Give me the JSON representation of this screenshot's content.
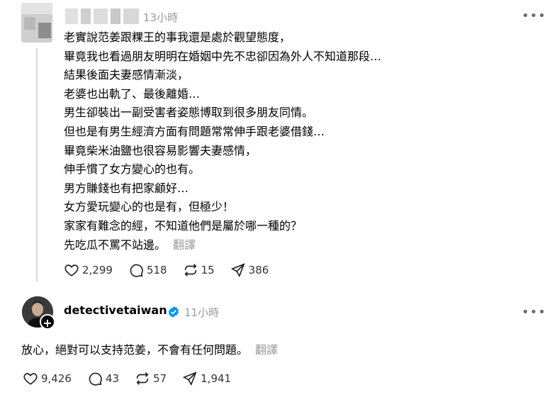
{
  "post": {
    "time": "13小時",
    "more_icon": "more-horizontal-icon",
    "lines": [
      "老實說范姜跟粿王的事我還是處於觀望態度，",
      "畢竟我也看過朋友明明在婚姻中先不忠卻因為外人不知道那段…",
      "結果後面夫妻感情漸淡，",
      "老婆也出軌了、最後離婚…",
      "男生卻裝出一副受害者姿態博取到很多朋友同情。",
      "但也是有男生經濟方面有問題常常伸手跟老婆借錢…",
      "畢竟柴米油鹽也很容易影響夫妻感情，",
      "伸手慣了女方變心的也有。",
      "男方賺錢也有把家顧好…",
      "女方愛玩變心的也是有，但極少！",
      "家家有難念的經，不知道他們是屬於哪一種的？",
      "先吃瓜不罵不站邊。"
    ],
    "translate": "翻譯",
    "likes": "2,299",
    "comments": "518",
    "reposts": "15",
    "shares": "386"
  },
  "reply": {
    "username": "detectivetaiwan",
    "time": "11小時",
    "text": "放心，絕對可以支持范姜，不會有任何問題。",
    "translate": "翻譯",
    "likes": "9,426",
    "comments": "43",
    "reposts": "57",
    "shares": "1,941"
  },
  "colors": {
    "verified": "#0095f6",
    "muted": "#999999",
    "thread_line": "#d9d9d9"
  }
}
